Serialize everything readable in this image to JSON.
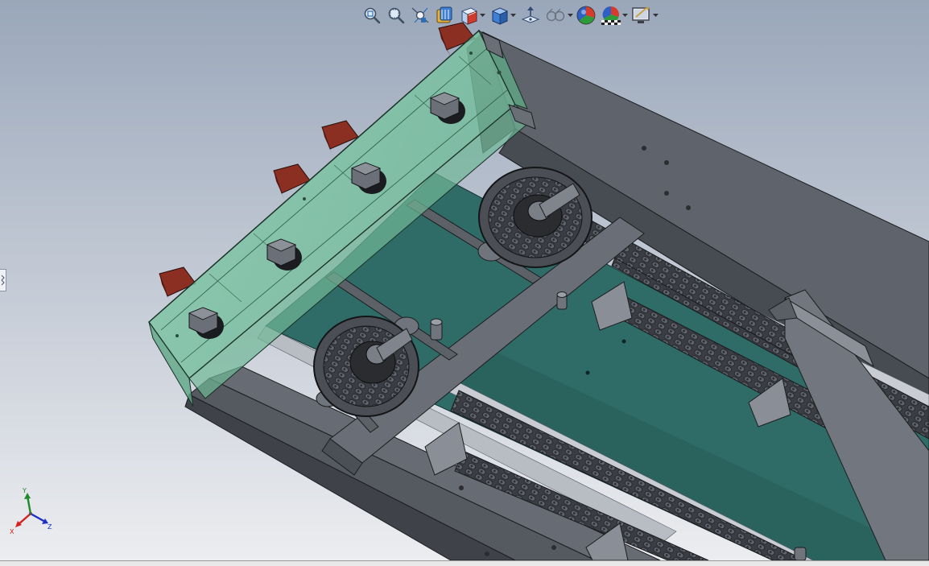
{
  "toolbar": {
    "buttons": [
      {
        "id": "zoom-to-fit",
        "icon": "zoom-to-fit-icon",
        "dropdown": false
      },
      {
        "id": "zoom-to-area",
        "icon": "zoom-to-area-icon",
        "dropdown": false
      },
      {
        "id": "previous-view",
        "icon": "previous-view-icon",
        "dropdown": false
      },
      {
        "id": "section-view",
        "icon": "section-view-icon",
        "dropdown": false
      },
      {
        "id": "view-orientation",
        "icon": "view-orientation-icon",
        "dropdown": true
      },
      {
        "id": "display-style",
        "icon": "display-style-icon",
        "dropdown": true
      },
      {
        "id": "hide-show-items",
        "icon": "hide-show-items-icon",
        "dropdown": false
      },
      {
        "id": "edit-appearance",
        "icon": "edit-appearance-icon",
        "dropdown": true
      },
      {
        "id": "apply-scene",
        "icon": "apply-scene-icon",
        "dropdown": false
      },
      {
        "id": "view-settings",
        "icon": "view-settings-icon",
        "dropdown": true
      },
      {
        "id": "display-manager",
        "icon": "display-manager-icon",
        "dropdown": true
      }
    ]
  },
  "triad": {
    "x_label": "X",
    "y_label": "Y",
    "z_label": "Z",
    "x_color": "#d42020",
    "y_color": "#1f8a2a",
    "z_color": "#1a2fc8"
  },
  "colors": {
    "background_top": "#9aa7ba",
    "background_bottom": "#ecedf0",
    "frame_steel": "#6b6f78",
    "frame_steel_dark": "#4c5058",
    "frame_steel_light": "#8a8e97",
    "conveyor_bed": "#2f6f6a",
    "guard_glass": "#7ec9a6",
    "bracket_red": "#8a2f22"
  }
}
